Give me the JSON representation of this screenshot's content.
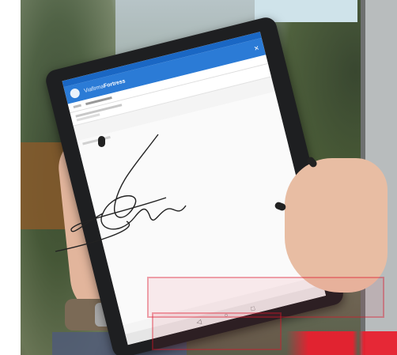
{
  "scene": {
    "description_free": true
  },
  "app": {
    "title_light": "Viafirma",
    "title_bold": "Fortress",
    "close_glyph": "✕",
    "colors": {
      "app_bar": "#2b7bd6",
      "status_bar": "#1a67c4"
    }
  },
  "signature": {
    "color": "#222222"
  },
  "overlay": {
    "color": "#e8202f"
  }
}
